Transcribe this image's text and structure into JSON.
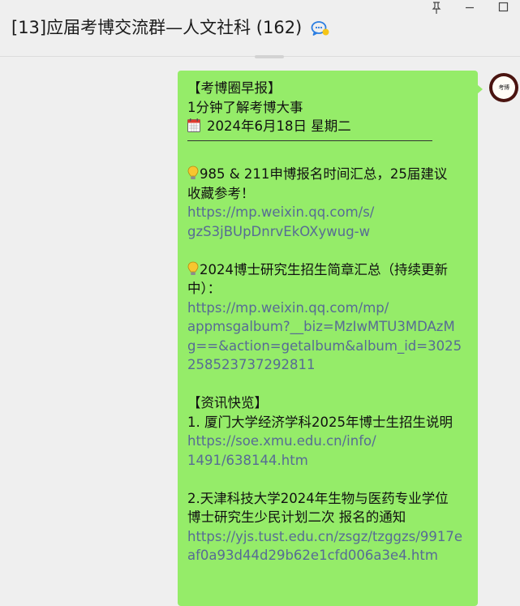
{
  "window": {
    "title": "[13]应届考博交流群—人文社科 (162)",
    "title_icon": "chat-bubbles-icon",
    "controls": [
      "pin-icon",
      "minimize-icon",
      "maximize-icon"
    ]
  },
  "avatar": {
    "text": "考博",
    "icon": "avatar-seal"
  },
  "message": {
    "heading": "【考博圈早报】",
    "subheading": "1分钟了解考博大事",
    "date_line": "2024年6月18日  星期二",
    "items": [
      {
        "title_lines": [
          "985 & 211申博报名时间汇总，25届建议",
          "收藏参考！"
        ],
        "link_lines": [
          "https://mp.weixin.qq.com/s/",
          "gzS3jBUpDnrvEkOXywug-w"
        ]
      },
      {
        "title_lines": [
          "2024博士研究生招生简章汇总（持续更新",
          "中）："
        ],
        "link_lines": [
          "https://mp.weixin.qq.com/mp/",
          "appmsgalbum?__biz=MzIwMTU3MDAzM",
          "g==&action=getalbum&album_id=3025",
          "258523737292811"
        ]
      }
    ],
    "news_heading": "【资讯快览】",
    "news": [
      {
        "title_lines": [
          "1.  厦门大学经济学科2025年博士生招生说明"
        ],
        "link_lines": [
          "https://soe.xmu.edu.cn/info/",
          "1491/638144.htm"
        ]
      },
      {
        "title_lines": [
          "2.天津科技大学2024年生物与医药专业学位",
          "博士研究生少民计划二次 报名的通知"
        ],
        "link_lines": [
          "https://yjs.tust.edu.cn/zsgz/tzggzs/9917e",
          "af0a93d44d29b62e1cfd006a3e4.htm"
        ]
      }
    ],
    "colors": {
      "bubble": "#95ec69",
      "link": "#576b95",
      "background": "#efefef"
    }
  }
}
